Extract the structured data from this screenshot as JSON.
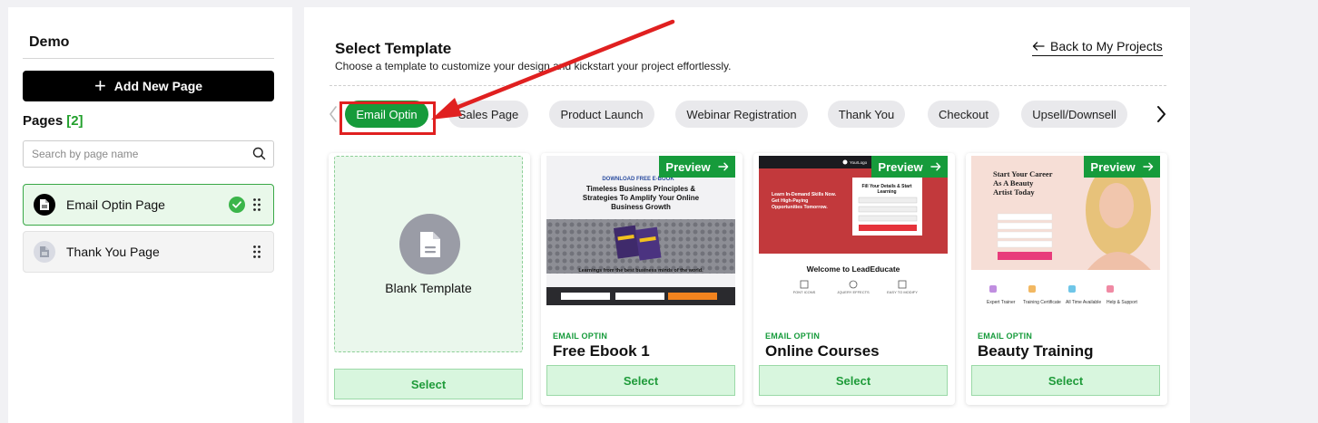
{
  "sidebar": {
    "project_name": "Demo",
    "add_page_label": "Add New Page",
    "pages_label": "Pages",
    "pages_count": "[2]",
    "search_placeholder": "Search by page name",
    "pages": [
      {
        "label": "Email Optin Page",
        "active": true
      },
      {
        "label": "Thank You Page",
        "active": false
      }
    ]
  },
  "main": {
    "title": "Select Template",
    "subtitle": "Choose a template to customize your design and kickstart your project effortlessly.",
    "back_label": "Back to My Projects",
    "tabs": [
      {
        "label": "Email Optin",
        "active": true
      },
      {
        "label": "Sales Page"
      },
      {
        "label": "Product Launch"
      },
      {
        "label": "Webinar Registration"
      },
      {
        "label": "Thank You"
      },
      {
        "label": "Checkout"
      },
      {
        "label": "Upsell/Downsell"
      }
    ],
    "templates": {
      "blank": {
        "label": "Blank Template",
        "select_label": "Select"
      },
      "items": [
        {
          "category": "EMAIL OPTIN",
          "title": "Free Ebook 1",
          "preview_label": "Preview",
          "select_label": "Select",
          "thumb": {
            "kicker": "DOWNLOAD FREE E-BOOK",
            "headline": "Timeless Business Principles & Strategies To Amplify Your Online Business Growth",
            "book_text": "PRODUCT IMAGE",
            "footer": "Learnings from the best business minds of the world.",
            "field1": "Your Name",
            "field2": "Your Email",
            "cta": "GET INSTANT ACCESS"
          }
        },
        {
          "category": "EMAIL OPTIN",
          "title": "Online Courses",
          "preview_label": "Preview",
          "select_label": "Select",
          "thumb": {
            "logo": "YourLogo",
            "hero_text": "Learn In-Demand Skills Now. Get High-Paying Opportunities Tomorrow.",
            "hero_sub": "Choose from over 30,000+ courses of your choice",
            "form_title": "Fill Your Details & Start Learning",
            "field1": "Your Name",
            "field2": "Email ID",
            "field3": "Your Course",
            "cta": "START TODAY WITH ME",
            "welcome": "Welcome to LeadEducate",
            "features": [
              "FONT ICONS",
              "JQUERY EFFECTS",
              "EASY TO MODIFY"
            ]
          }
        },
        {
          "category": "EMAIL OPTIN",
          "title": "Beauty Training",
          "preview_label": "Preview",
          "select_label": "Select",
          "thumb": {
            "headline": "Start Your Career As A Beauty Artist Today",
            "sub": "Get trained to become a professional makeup artist with our exclusive course.",
            "field1": "Full Name",
            "field2": "Email ID",
            "field3": "Phone No.",
            "field4": "Course",
            "cta": "REQUEST A CALL BACK",
            "features": [
              "Expert Trainer",
              "Training Certificate",
              "All Time Available",
              "Help & Support"
            ]
          }
        }
      ]
    }
  },
  "colors": {
    "accent_green": "#169b3b",
    "annotation_red": "#e02020",
    "sidebar_active_bg": "#e9f8ea"
  },
  "icons": [
    "plus-icon",
    "search-icon",
    "document-icon",
    "check-circle-icon",
    "drag-handle-icon",
    "arrow-left-icon",
    "chevron-left-icon",
    "chevron-right-icon",
    "arrow-right-icon"
  ]
}
